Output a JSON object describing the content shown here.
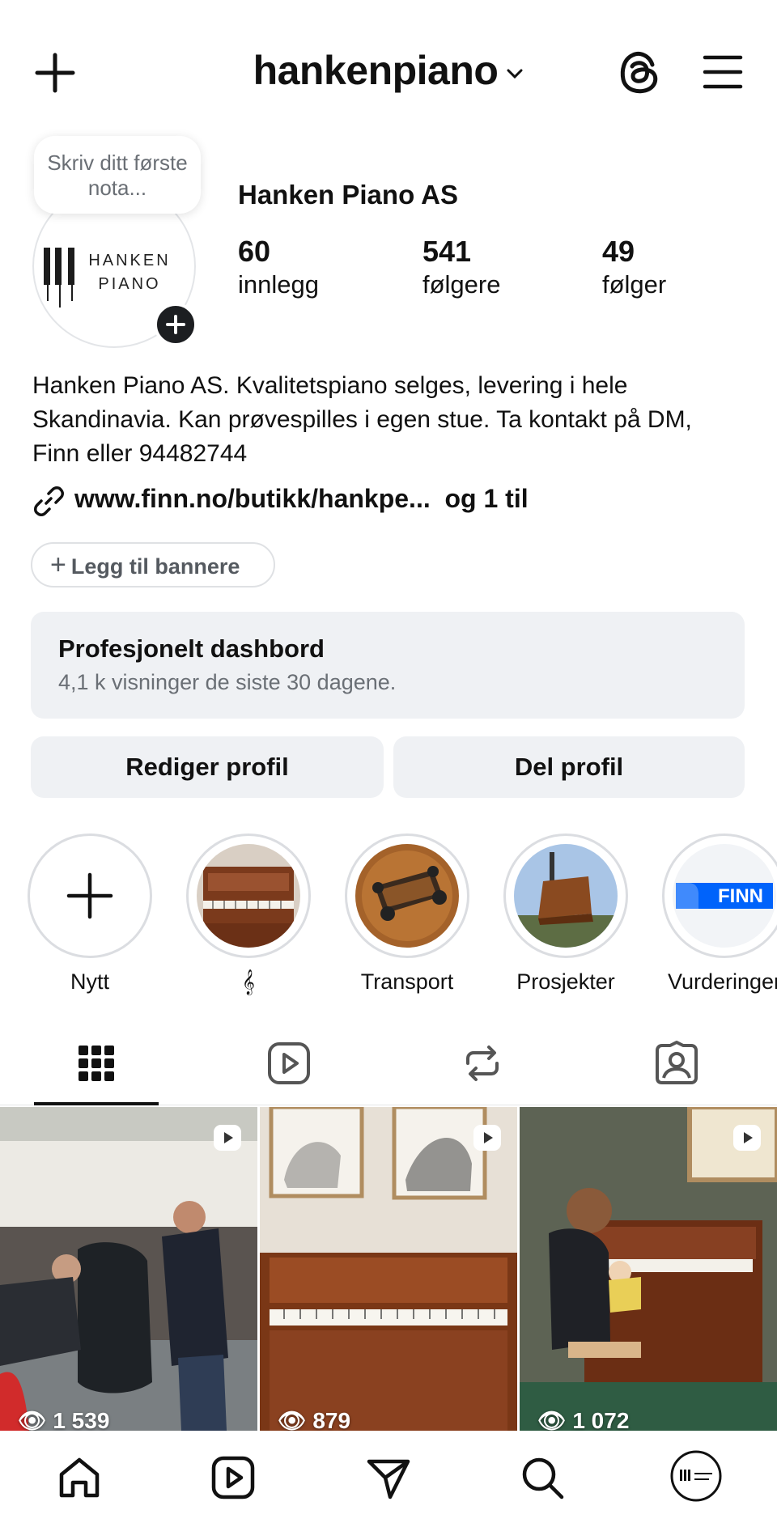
{
  "header": {
    "username": "hankenpiano"
  },
  "profile": {
    "note_placeholder": "Skriv ditt første nota...",
    "logo_line1": "HANKEN",
    "logo_line2": "PIANO",
    "name": "Hanken Piano AS",
    "stats": [
      {
        "value": "60",
        "label": "innlegg"
      },
      {
        "value": "541",
        "label": "følgere"
      },
      {
        "value": "49",
        "label": "følger"
      }
    ],
    "bio": "Hanken Piano AS. Kvalitetspiano selges, levering i hele Skandinavia. Kan prøvespilles i egen stue. Ta kontakt på DM, Finn eller 94482744",
    "link_text": "www.finn.no/butikk/hankpe...",
    "link_more": "og 1 til"
  },
  "banner_button": "Legg til bannere",
  "dashboard": {
    "title": "Profesjonelt dashbord",
    "subtitle": "4,1 k visninger de siste 30 dagene."
  },
  "actions": {
    "edit": "Rediger profil",
    "share": "Del profil"
  },
  "highlights": [
    {
      "label": "Nytt",
      "icon": "plus-icon"
    },
    {
      "label": "𝄞",
      "icon": "piano-image"
    },
    {
      "label": "Transport",
      "icon": "dolly-image"
    },
    {
      "label": "Prosjekter",
      "icon": "crane-image"
    },
    {
      "label": "Vurderinger",
      "icon": "finn-logo",
      "logo_text": "FINN"
    }
  ],
  "tabs": [
    "grid-icon",
    "reels-icon",
    "repost-icon",
    "tagged-icon"
  ],
  "posts": [
    {
      "views": "1 539",
      "type": "reel"
    },
    {
      "views": "879",
      "type": "reel"
    },
    {
      "views": "1 072",
      "type": "reel"
    }
  ],
  "bottom_nav": [
    "home-icon",
    "reels-icon",
    "send-icon",
    "search-icon",
    "profile-avatar"
  ],
  "colors": {
    "button_bg": "#eff1f4",
    "text_secondary": "#6a6f75",
    "finn_blue": "#0063fb"
  }
}
